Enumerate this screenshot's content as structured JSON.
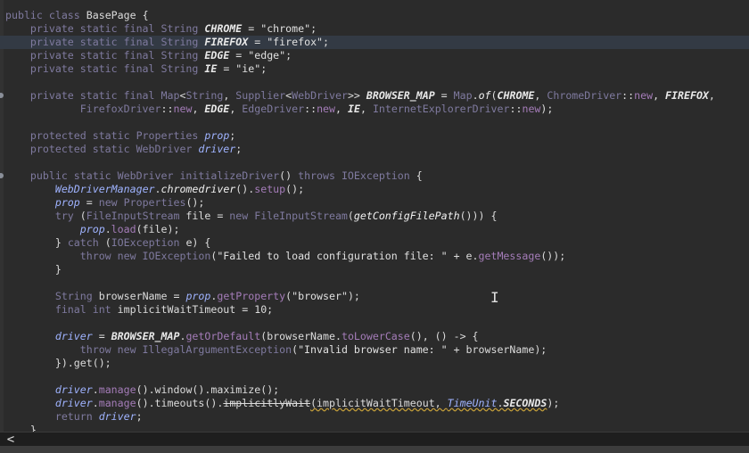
{
  "editor": {
    "lines": [
      "public class BasePage {",
      "    private static final String CHROME = \"chrome\";",
      "    private static final String FIREFOX = \"firefox\";",
      "    private static final String EDGE = \"edge\";",
      "    private static final String IE = \"ie\";",
      "",
      "    private static final Map<String, Supplier<WebDriver>> BROWSER_MAP = Map.of(CHROME, ChromeDriver::new, FIREFOX,",
      "            FirefoxDriver::new, EDGE, EdgeDriver::new, IE, InternetExplorerDriver::new);",
      "",
      "    protected static Properties prop;",
      "    protected static WebDriver driver;",
      "",
      "    public static WebDriver initializeDriver() throws IOException {",
      "        WebDriverManager.chromedriver().setup();",
      "        prop = new Properties();",
      "        try (FileInputStream file = new FileInputStream(getConfigFilePath())) {",
      "            prop.load(file);",
      "        } catch (IOException e) {",
      "            throw new IOException(\"Failed to load configuration file: \" + e.getMessage());",
      "        }",
      "",
      "        String browserName = prop.getProperty(\"browser\");",
      "        final int implicitWaitTimeout = 10;",
      "",
      "        driver = BROWSER_MAP.getOrDefault(browserName.toLowerCase(), () -> {",
      "            throw new IllegalArgumentException(\"Invalid browser name: \" + browserName);",
      "        }).get();",
      "",
      "        driver.manage().window().maximize();",
      "        driver.manage().timeouts().implicitlyWait(implicitWaitTimeout, TimeUnit.SECONDS);",
      "        return driver;",
      "    }"
    ]
  },
  "icons": {
    "cursor": "text-cursor-icon",
    "scroll_left": "chevron-left-icon"
  },
  "scrollbar": {
    "left_glyph": "<"
  },
  "cursor_glyph": "I"
}
